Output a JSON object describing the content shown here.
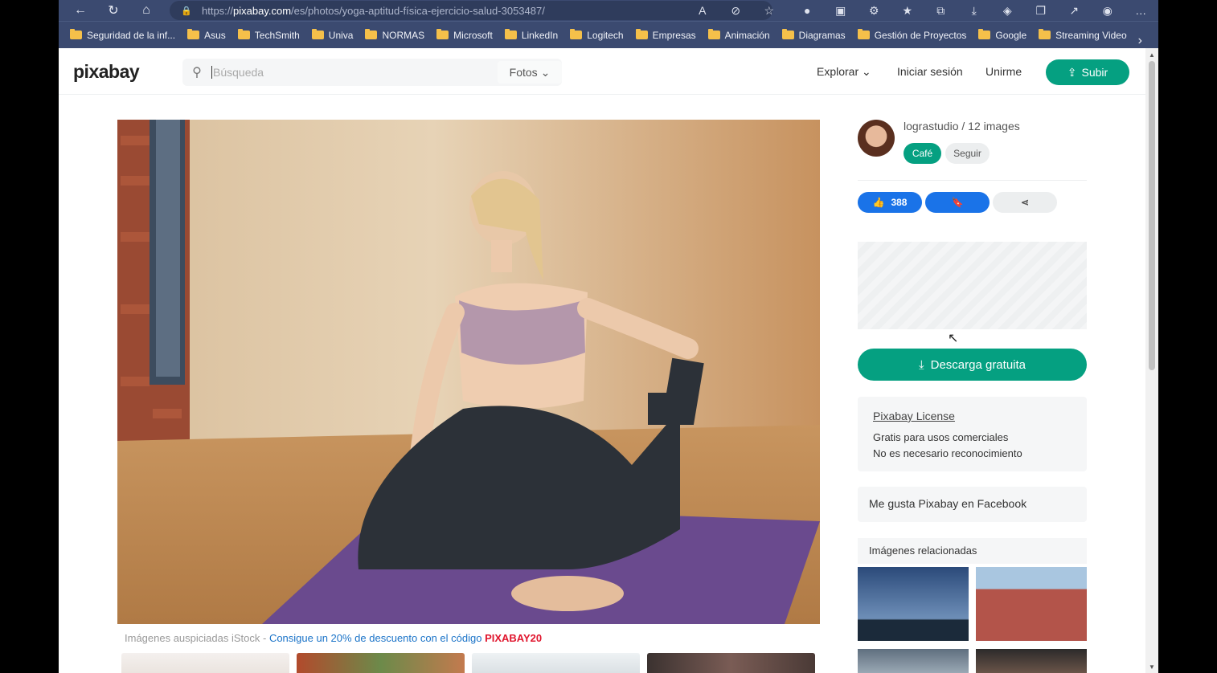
{
  "browser": {
    "url_prefix": "https://",
    "url_host": "pixabay.com",
    "url_path": "/es/photos/yoga-aptitud-física-ejercicio-salud-3053487/",
    "bookmarks": [
      "Seguridad de la inf...",
      "Asus",
      "TechSmith",
      "Univa",
      "NORMAS",
      "Microsoft",
      "LinkedIn",
      "Logitech",
      "Empresas",
      "Animación",
      "Diagramas",
      "Gestión de Proyectos",
      "Google",
      "Streaming Video"
    ]
  },
  "header": {
    "logo": "pixabay",
    "search_placeholder": "Búsqueda",
    "search_type": "Fotos",
    "explore": "Explorar",
    "login": "Iniciar sesión",
    "join": "Unirme",
    "upload": "Subir"
  },
  "sponsor": {
    "prefix": "Imágenes auspiciadas iStock - ",
    "link": "Consigue un 20% de descuento con el código ",
    "code": "PIXABAY20"
  },
  "sidebar": {
    "author": "lograstudio / 12 images",
    "cafe": "Café",
    "follow": "Seguir",
    "likes": "388",
    "download": "Descarga gratuita",
    "license_title": "Pixabay License",
    "license_line1": "Gratis para usos comerciales",
    "license_line2": "No es necesario reconocimiento",
    "facebook": "Me gusta Pixabay en Facebook",
    "related": "Imágenes relacionadas"
  },
  "colors": {
    "accent_green": "#05a081",
    "like_blue": "#1a73e8",
    "chrome_bg": "#3b4a70"
  }
}
